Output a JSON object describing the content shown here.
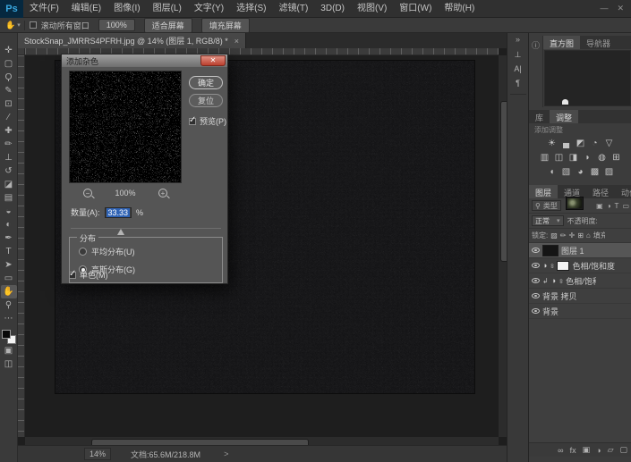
{
  "menubar": {
    "logo": "Ps",
    "items": [
      "文件(F)",
      "编辑(E)",
      "图像(I)",
      "图层(L)",
      "文字(Y)",
      "选择(S)",
      "滤镜(T)",
      "3D(D)",
      "视图(V)",
      "窗口(W)",
      "帮助(H)"
    ],
    "window_controls": [
      "—",
      "✕"
    ]
  },
  "optionsbar": {
    "tool_glyph": "✋",
    "caret": "▾",
    "scroll_all_windows": "滚动所有窗口",
    "zoom_100": "100%",
    "fit_screen": "适合屏幕",
    "fill_screen": "填充屏幕"
  },
  "document": {
    "tab_title": "StockSnap_JMRRS4PFRH.jpg @ 14% (图层 1, RGB/8) *",
    "close": "×"
  },
  "toolbar": {
    "tools": [
      {
        "name": "move-tool",
        "glyph": "✛"
      },
      {
        "name": "marquee-tool",
        "glyph": "▢"
      },
      {
        "name": "lasso-tool",
        "glyph": "Ϙ"
      },
      {
        "name": "quick-selection-tool",
        "glyph": "✎"
      },
      {
        "name": "crop-tool",
        "glyph": "⊡"
      },
      {
        "name": "eyedropper-tool",
        "glyph": "⁄"
      },
      {
        "name": "healing-brush-tool",
        "glyph": "✚"
      },
      {
        "name": "brush-tool",
        "glyph": "✏"
      },
      {
        "name": "clone-stamp-tool",
        "glyph": "⊥"
      },
      {
        "name": "history-brush-tool",
        "glyph": "↺"
      },
      {
        "name": "eraser-tool",
        "glyph": "◪"
      },
      {
        "name": "gradient-tool",
        "glyph": "▤"
      },
      {
        "name": "blur-tool",
        "glyph": "◒"
      },
      {
        "name": "dodge-tool",
        "glyph": "◐"
      },
      {
        "name": "pen-tool",
        "glyph": "✒"
      },
      {
        "name": "type-tool",
        "glyph": "T"
      },
      {
        "name": "path-select-tool",
        "glyph": "➤"
      },
      {
        "name": "shape-tool",
        "glyph": "▭"
      },
      {
        "name": "hand-tool",
        "glyph": "✋",
        "active": true
      },
      {
        "name": "zoom-tool",
        "glyph": "⚲"
      },
      {
        "name": "more-tools",
        "glyph": "⋯"
      }
    ],
    "quick_mask_glyph": "▣",
    "screen_mode_glyph": "◫"
  },
  "dialog": {
    "title": "添加杂色",
    "close": "✕",
    "ok": "确定",
    "reset": "复位",
    "preview_label": "预览(P)",
    "zoom_out": "−",
    "zoom_level": "100%",
    "zoom_in": "+",
    "amount_label": "数量(A):",
    "amount_value": "33.33",
    "percent": "%",
    "distribution_label": "分布",
    "uniform_label": "平均分布(U)",
    "gaussian_label": "高斯分布(G)",
    "monochromatic_label": "单色(M)"
  },
  "strip": {
    "expand": "»",
    "icons": [
      {
        "name": "clone-source-panel",
        "glyph": "⊥"
      },
      {
        "name": "character-panel",
        "glyph": "A|"
      },
      {
        "name": "paragraph-panel",
        "glyph": "¶"
      }
    ]
  },
  "panels": {
    "histogram": {
      "info_icon": "ⓘ",
      "tab_active": "直方图",
      "tab_inactive": "导航器"
    },
    "adjustments": {
      "tab_library": "库",
      "tab_active": "调整",
      "add_label": "添加调整",
      "icon_rows": [
        [
          {
            "name": "brightness-contrast",
            "glyph": "☀"
          },
          {
            "name": "levels",
            "glyph": "▄"
          },
          {
            "name": "curves",
            "glyph": "◩"
          },
          {
            "name": "exposure",
            "glyph": "◔"
          },
          {
            "name": "vibrance",
            "glyph": "▽"
          }
        ],
        [
          {
            "name": "hue-saturation",
            "glyph": "▥"
          },
          {
            "name": "color-balance",
            "glyph": "◫"
          },
          {
            "name": "black-white",
            "glyph": "◨"
          },
          {
            "name": "photo-filter",
            "glyph": "◗"
          },
          {
            "name": "channel-mixer",
            "glyph": "◍"
          },
          {
            "name": "color-lookup",
            "glyph": "⊞"
          }
        ],
        [
          {
            "name": "invert",
            "glyph": "◖"
          },
          {
            "name": "posterize",
            "glyph": "▧"
          },
          {
            "name": "threshold",
            "glyph": "◕"
          },
          {
            "name": "gradient-map",
            "glyph": "▩"
          },
          {
            "name": "selective-color",
            "glyph": "▨"
          }
        ]
      ]
    },
    "layers": {
      "tabs": [
        "图层",
        "通道",
        "路径",
        "动作"
      ],
      "active_tab": "图层",
      "filter": {
        "search_glyph": "⚲",
        "kind_label": "类型",
        "caret": "▾",
        "icons": [
          {
            "name": "filter-image",
            "glyph": "▣"
          },
          {
            "name": "filter-adjustment",
            "glyph": "◑"
          },
          {
            "name": "filter-type",
            "glyph": "T"
          },
          {
            "name": "filter-shape",
            "glyph": "▭"
          }
        ]
      },
      "blend": {
        "mode": "正常",
        "caret": "▾",
        "opacity_label": "不透明度:"
      },
      "lock": {
        "label": "锁定:",
        "icons": [
          {
            "name": "lock-transparency",
            "glyph": "▨"
          },
          {
            "name": "lock-pixels",
            "glyph": "✏"
          },
          {
            "name": "lock-position",
            "glyph": "✛"
          },
          {
            "name": "lock-artboard",
            "glyph": "⊞"
          },
          {
            "name": "lock-all",
            "glyph": "⌂"
          }
        ],
        "fill_label": "填充:"
      },
      "rows": [
        {
          "name": "图层 1"
        },
        {
          "name": "色相/饱和度",
          "adj_glyph": "◑",
          "link_glyph": "∞"
        },
        {
          "name": "色相/饱和度",
          "clip_glyph": "↲",
          "adj_glyph": "◑",
          "link_glyph": "∞"
        },
        {
          "name": "背景 拷贝"
        },
        {
          "name": "背景"
        }
      ],
      "bottom_icons": [
        {
          "name": "link-layers",
          "glyph": "∞"
        },
        {
          "name": "layer-effects",
          "glyph": "fx"
        },
        {
          "name": "add-layer-mask",
          "glyph": "▣"
        },
        {
          "name": "add-adjustment-layer",
          "glyph": "◑"
        },
        {
          "name": "new-group",
          "glyph": "▱"
        },
        {
          "name": "new-layer",
          "glyph": "▢"
        }
      ]
    }
  },
  "statusbar": {
    "zoom": "14%",
    "doc_info": "文档:65.6M/218.8M",
    "arrow": ">"
  }
}
